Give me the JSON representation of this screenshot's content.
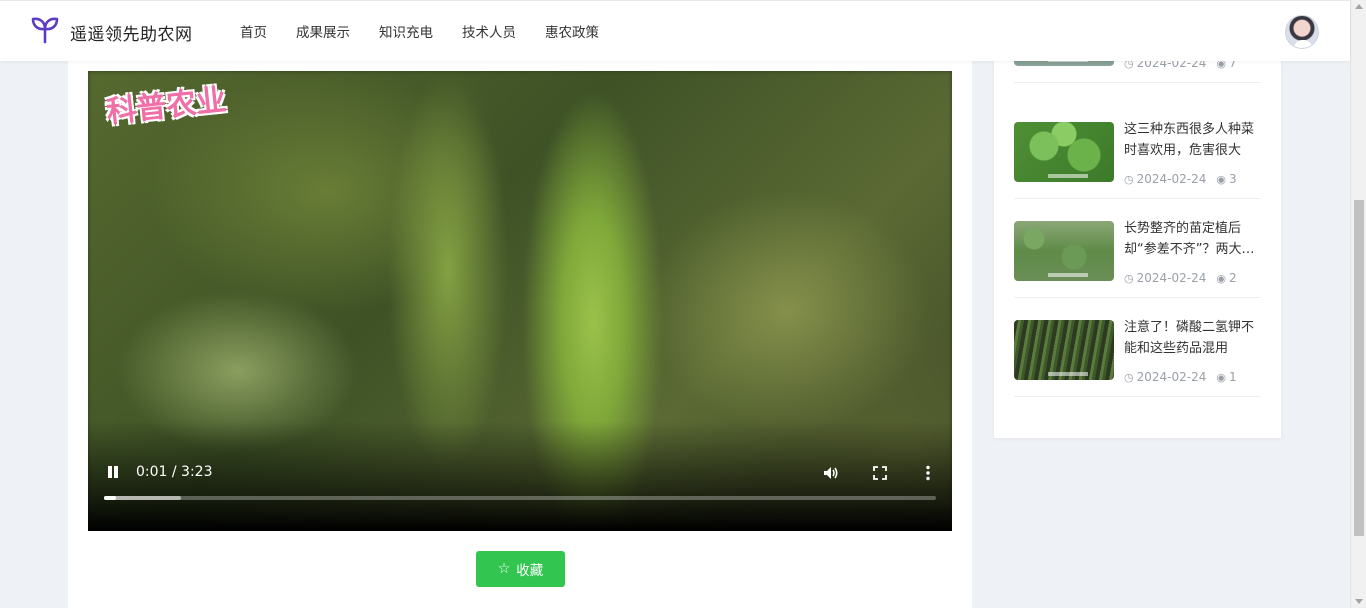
{
  "header": {
    "site_name": "遥遥领先助农网",
    "logo_icon": "sprout-icon",
    "nav": [
      "首页",
      "成果展示",
      "知识充电",
      "技术人员",
      "惠农政策"
    ]
  },
  "video": {
    "watermark": "科普农业",
    "current_time": "0:01",
    "duration": "3:23",
    "time_display": "0:01 / 3:23",
    "played_fraction": 0.015,
    "buffered_fraction": 0.092,
    "controls": [
      "pause-icon",
      "volume-icon",
      "fullscreen-icon",
      "more-options-icon"
    ]
  },
  "actions": {
    "favorite_label": "收藏",
    "favorite_color": "#32c650"
  },
  "sidebar": {
    "items": [
      {
        "title": "",
        "date": "2024-02-24",
        "views": "7"
      },
      {
        "title": "这三种东西很多人种菜时喜欢用，危害很大",
        "date": "2024-02-24",
        "views": "3"
      },
      {
        "title": "长势整齐的苗定植后却“参差不齐”？两大原因",
        "date": "2024-02-24",
        "views": "2"
      },
      {
        "title": "注意了！磷酸二氢钾不能和这些药品混用",
        "date": "2024-02-24",
        "views": "1"
      }
    ]
  }
}
